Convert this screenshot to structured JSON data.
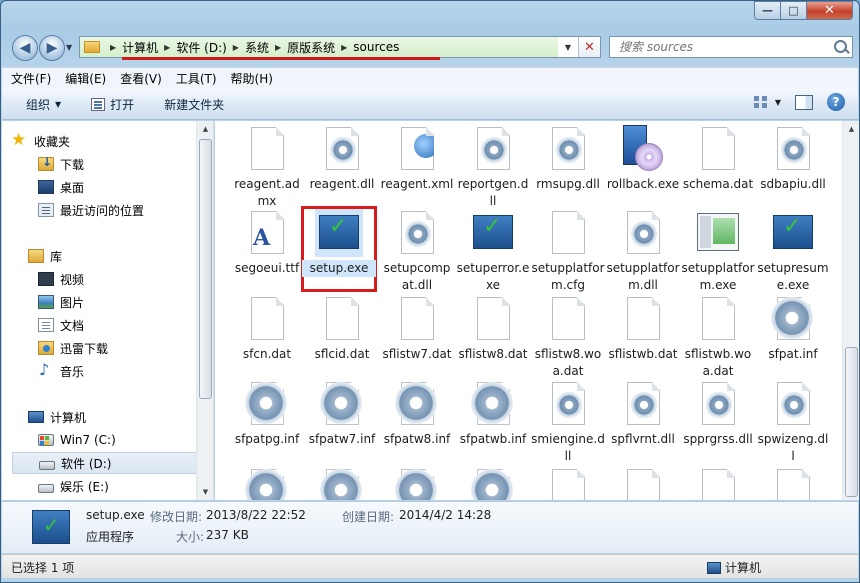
{
  "window": {
    "minimize": "—",
    "maximize": "□",
    "close": "✕"
  },
  "nav": {
    "back": "◀",
    "forward": "▶"
  },
  "address": {
    "crumbs": [
      "计算机",
      "软件 (D:)",
      "系统",
      "原版系统",
      "sources"
    ]
  },
  "search": {
    "placeholder": "搜索 sources"
  },
  "menu": [
    "文件(F)",
    "编辑(E)",
    "查看(V)",
    "工具(T)",
    "帮助(H)"
  ],
  "toolbar": {
    "organize": "组织",
    "open": "打开",
    "new_folder": "新建文件夹"
  },
  "navpane": {
    "favorites": "收藏夹",
    "downloads": "下载",
    "desktop": "桌面",
    "recent": "最近访问的位置",
    "libraries": "库",
    "videos": "视频",
    "pictures": "图片",
    "documents": "文档",
    "thunder": "迅雷下载",
    "music": "音乐",
    "computer": "计算机",
    "drive_c": "Win7 (C:)",
    "drive_d": "软件 (D:)",
    "drive_e": "娱乐 (E:)"
  },
  "files": [
    {
      "name": "reagent.admx",
      "icon": "page"
    },
    {
      "name": "reagent.dll",
      "icon": "gear-page"
    },
    {
      "name": "reagent.xml",
      "icon": "xml-page"
    },
    {
      "name": "reportgen.dll",
      "icon": "gear-page"
    },
    {
      "name": "rmsupg.dll",
      "icon": "gear-page"
    },
    {
      "name": "rollback.exe",
      "icon": "cd-box"
    },
    {
      "name": "schema.dat",
      "icon": "page"
    },
    {
      "name": "sdbapiu.dll",
      "icon": "gear-page"
    },
    {
      "name": "segoeui.ttf",
      "icon": "font"
    },
    {
      "name": "setup.exe",
      "icon": "setup-exe",
      "selected": true
    },
    {
      "name": "setupcompat.dll",
      "icon": "gear-page"
    },
    {
      "name": "setuperror.exe",
      "icon": "setup-exe"
    },
    {
      "name": "setupplatform.cfg",
      "icon": "page"
    },
    {
      "name": "setupplatform.dll",
      "icon": "gear-page"
    },
    {
      "name": "setupplatform.exe",
      "icon": "app-window"
    },
    {
      "name": "setupresume.exe",
      "icon": "setup-exe"
    },
    {
      "name": "sfcn.dat",
      "icon": "page"
    },
    {
      "name": "sflcid.dat",
      "icon": "page"
    },
    {
      "name": "sflistw7.dat",
      "icon": "page"
    },
    {
      "name": "sflistw8.dat",
      "icon": "page"
    },
    {
      "name": "sflistw8.woa.dat",
      "icon": "page"
    },
    {
      "name": "sflistwb.dat",
      "icon": "page"
    },
    {
      "name": "sflistwb.woa.dat",
      "icon": "page"
    },
    {
      "name": "sfpat.inf",
      "icon": "gear-big"
    },
    {
      "name": "sfpatpg.inf",
      "icon": "gear-big"
    },
    {
      "name": "sfpatw7.inf",
      "icon": "gear-big"
    },
    {
      "name": "sfpatw8.inf",
      "icon": "gear-big"
    },
    {
      "name": "sfpatwb.inf",
      "icon": "gear-big"
    },
    {
      "name": "smiengine.dll",
      "icon": "gear-page"
    },
    {
      "name": "spflvrnt.dll",
      "icon": "gear-page"
    },
    {
      "name": "spprgrss.dll",
      "icon": "gear-page"
    },
    {
      "name": "spwizeng.dll",
      "icon": "gear-page"
    }
  ],
  "partial_row_icons": [
    "gear-big",
    "gear-big",
    "gear-big",
    "gear-big",
    "page",
    "page",
    "page",
    "page"
  ],
  "details": {
    "name": "setup.exe",
    "type": "应用程序",
    "modified_label": "修改日期:",
    "modified_value": "2013/8/22 22:52",
    "created_label": "创建日期:",
    "created_value": "2014/4/2 14:28",
    "size_label": "大小:",
    "size_value": "237 KB"
  },
  "status": {
    "selection": "已选择 1 项",
    "location": "计算机"
  },
  "colors": {
    "highlight_red": "#d01818",
    "selection_blue": "#cfe5fa",
    "window_chrome": "#b8d5ec"
  }
}
